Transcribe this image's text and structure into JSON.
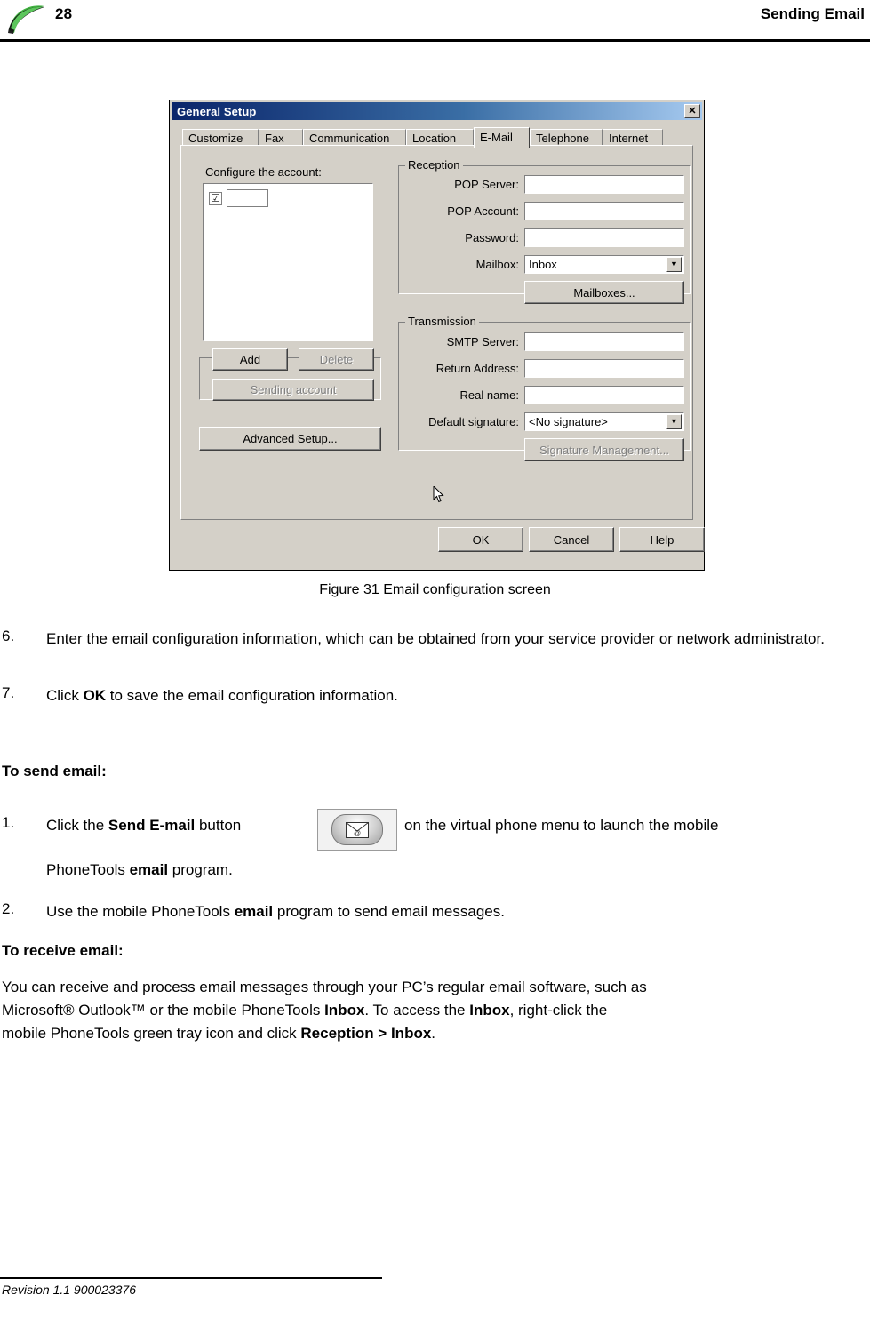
{
  "header": {
    "page_number": "28",
    "title": "Sending Email",
    "logo_icon": "swoosh-logo"
  },
  "dialog": {
    "title": "General Setup",
    "close_label": "✕",
    "tabs": [
      {
        "label": "Customize",
        "active": false
      },
      {
        "label": "Fax",
        "active": false
      },
      {
        "label": "Communication",
        "active": false
      },
      {
        "label": "Location",
        "active": false
      },
      {
        "label": "E-Mail",
        "active": true
      },
      {
        "label": "Telephone",
        "active": false
      },
      {
        "label": "Internet",
        "active": false
      }
    ],
    "account_group": {
      "label": "Configure the account:",
      "list_item_checkbox": "☑",
      "list_item_value": "",
      "buttons": {
        "add": "Add",
        "delete": "Delete",
        "sending_account": "Sending account",
        "advanced_setup": "Advanced Setup..."
      }
    },
    "reception": {
      "group_label": "Reception",
      "fields": [
        {
          "label": "POP Server:",
          "value": ""
        },
        {
          "label": "POP Account:",
          "value": ""
        },
        {
          "label": "Password:",
          "value": ""
        }
      ],
      "mailbox_label": "Mailbox:",
      "mailbox_value": "Inbox",
      "mailboxes_button": "Mailboxes..."
    },
    "transmission": {
      "group_label": "Transmission",
      "fields": [
        {
          "label": "SMTP Server:",
          "value": ""
        },
        {
          "label": "Return Address:",
          "value": ""
        },
        {
          "label": "Real name:",
          "value": ""
        }
      ],
      "signature_label": "Default signature:",
      "signature_value": "<No signature>",
      "signature_button": "Signature Management..."
    },
    "footer_buttons": {
      "ok": "OK",
      "cancel": "Cancel",
      "help": "Help"
    }
  },
  "figure_caption": "Figure 31 Email configuration screen",
  "steps": [
    {
      "number": "6.",
      "line1": "Enter the email configuration information, which can be obtained from your service provider",
      "line2": "or network administrator."
    },
    {
      "number": "7.",
      "text_before": "Click ",
      "bold": "OK",
      "text_after": " to save the email configuration information."
    }
  ],
  "send_section": {
    "heading": "To send email:",
    "item1": {
      "number": "1.",
      "part1": "Click the ",
      "bold1": "Send E-mail",
      "part2": " button",
      "part3": "on the virtual phone menu to launch the mobile",
      "line2_part1": "PhoneTools ",
      "line2_bold": "email",
      "line2_part2": " program.",
      "button_icon": "send-email-envelope-icon"
    },
    "item2": {
      "number": "2.",
      "part1": "Use the mobile PhoneTools ",
      "bold1": "email",
      "part2": " program to send email messages."
    }
  },
  "receive_section": {
    "heading": "To receive email:",
    "line1": "You can receive and process email messages through your PC’s regular email software, such as",
    "line2_part1": "Microsoft® Outlook™ or the mobile PhoneTools ",
    "line2_bold1": "Inbox",
    "line2_part2": ". To access the ",
    "line2_bold2": "Inbox",
    "line2_part3": ", right-click the",
    "line3_part1": "mobile PhoneTools green tray icon and click ",
    "line3_bold": "Reception > Inbox",
    "line3_part2": "."
  },
  "footer": {
    "text": "Revision 1.1 900023376"
  }
}
